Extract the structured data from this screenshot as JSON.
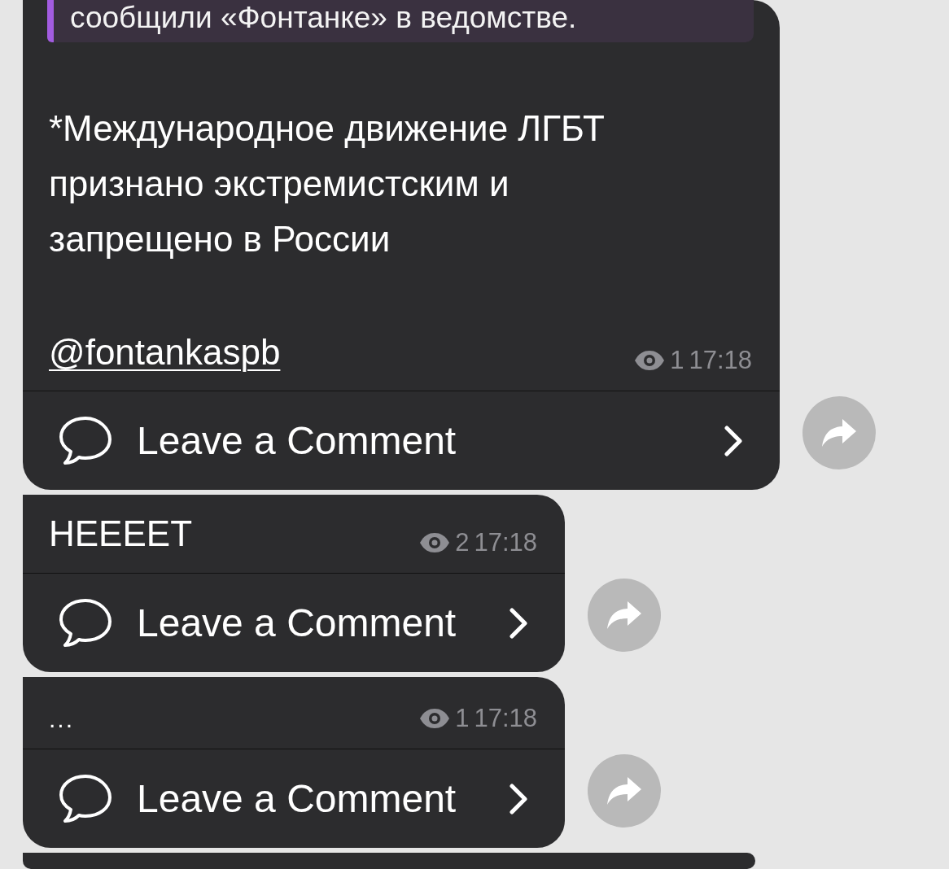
{
  "messages": [
    {
      "kind": "post",
      "quote": "сообщили «Фонтанке» в ведомстве.",
      "text": "*Международное движение ЛГБТ признано экстремистским и запрещено в России",
      "link": "@fontankaspb",
      "views": "1",
      "time": "17:18",
      "comment_label": "Leave a Comment"
    },
    {
      "kind": "post",
      "text": "НЕЕЕЕТ",
      "views": "2",
      "time": "17:18",
      "comment_label": "Leave a Comment"
    },
    {
      "kind": "post",
      "text": "...",
      "views": "1",
      "time": "17:18",
      "comment_label": "Leave a Comment"
    },
    {
      "kind": "partial"
    }
  ]
}
